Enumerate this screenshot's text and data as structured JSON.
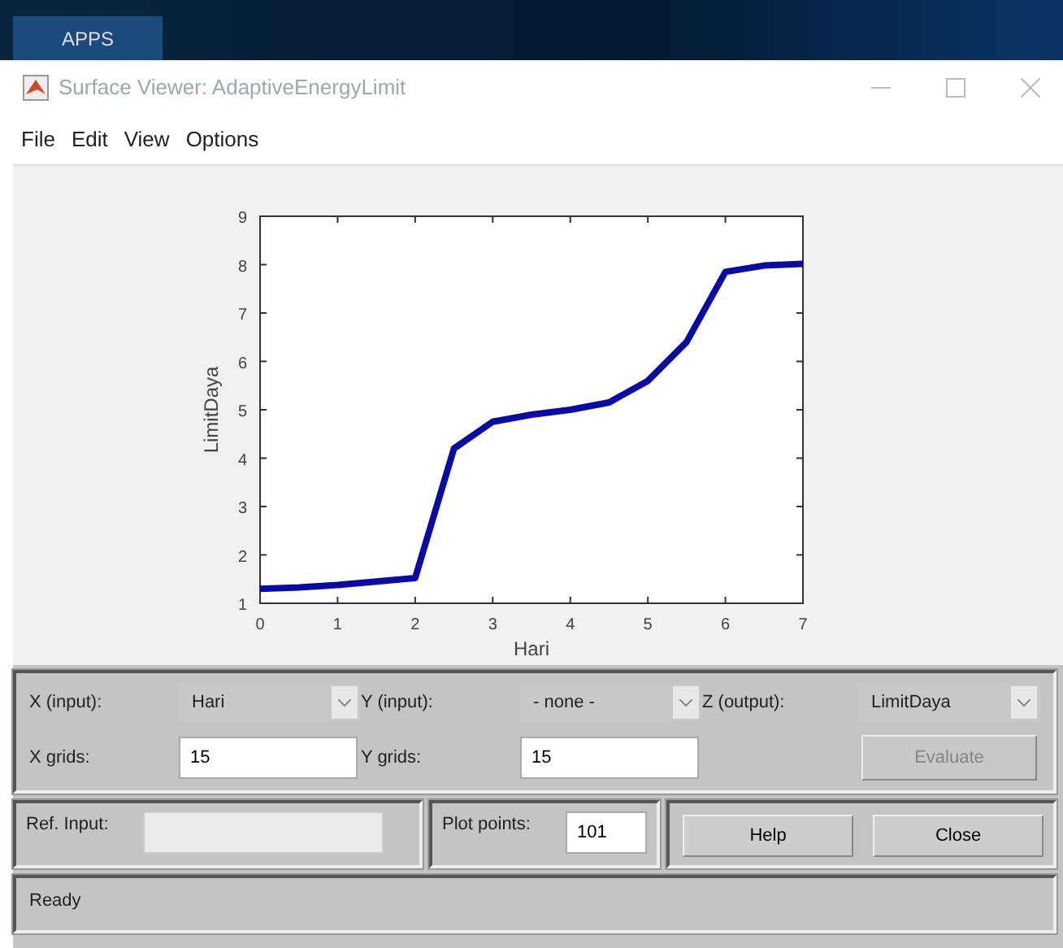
{
  "top_bar": {
    "tab": "APPS"
  },
  "window": {
    "title": "Surface Viewer: AdaptiveEnergyLimit"
  },
  "menu": [
    "File",
    "Edit",
    "View",
    "Options"
  ],
  "plot": {
    "chart_data": {
      "type": "line",
      "xlabel": "Hari",
      "ylabel": "LimitDaya",
      "x": [
        0,
        0.5,
        1,
        1.5,
        2,
        2.5,
        3,
        3.5,
        4,
        4.5,
        5,
        5.5,
        6,
        6.5,
        7
      ],
      "series": [
        {
          "color": "#0a0aa8",
          "values": [
            1.3,
            1.33,
            1.38,
            1.45,
            1.52,
            4.2,
            4.75,
            4.9,
            5.0,
            5.15,
            5.6,
            6.4,
            7.85,
            7.98,
            8.02
          ]
        }
      ],
      "xlim": [
        0,
        7
      ],
      "ylim": [
        1,
        9
      ],
      "xticks": [
        0,
        1,
        2,
        3,
        4,
        5,
        6,
        7
      ],
      "yticks": [
        1,
        2,
        3,
        4,
        5,
        6,
        7,
        8,
        9
      ]
    }
  },
  "selectors": [
    {
      "label": "X (input):",
      "value": "Hari"
    },
    {
      "label": "Y (input):",
      "value": "- none -"
    },
    {
      "label": "Z (output):",
      "value": "LimitDaya"
    }
  ],
  "grids": [
    {
      "label": "X grids:",
      "value": "15"
    },
    {
      "label": "Y grids:",
      "value": "15"
    }
  ],
  "evaluate": {
    "label": "Evaluate",
    "disabled": true
  },
  "ref_input": {
    "label": "Ref. Input:",
    "disabled": true
  },
  "plot_points": {
    "label": "Plot points:",
    "value": "101"
  },
  "buttons": [
    "Help",
    "Close"
  ],
  "status": "Ready"
}
